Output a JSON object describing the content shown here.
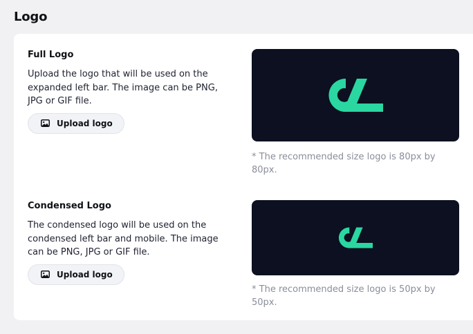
{
  "section": {
    "title": "Logo"
  },
  "full_logo": {
    "title": "Full Logo",
    "description": "Upload the logo that will be used on the expanded left bar. The image can be PNG, JPG or GIF file.",
    "button_label": "Upload logo",
    "hint": "* The recommended size logo is 80px by 80px."
  },
  "condensed_logo": {
    "title": "Condensed Logo",
    "description": "The condensed logo will be used on the condensed left bar and mobile. The image can be PNG, JPG or GIF file.",
    "button_label": "Upload logo",
    "hint": "* The recommended size logo is 50px by 50px."
  },
  "colors": {
    "brand_accent": "#2ad7a0",
    "preview_background": "#0c1020"
  },
  "icons": {
    "upload": "image-icon",
    "logo": "brand-logo-mark"
  }
}
